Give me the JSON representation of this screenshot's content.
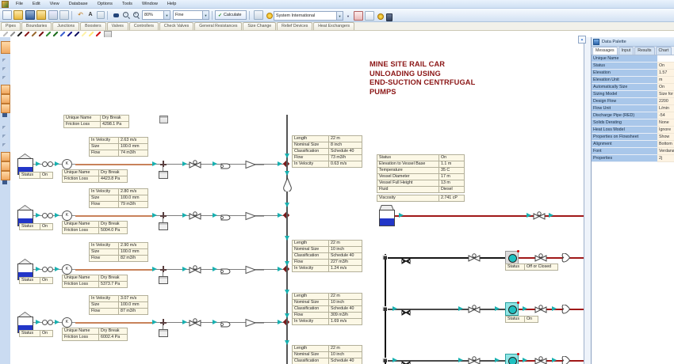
{
  "menu": {
    "items": [
      "File",
      "Edit",
      "View",
      "Database",
      "Options",
      "Tools",
      "Window",
      "Help"
    ]
  },
  "toolbar": {
    "zoom": "80%",
    "detail": "Fine",
    "calculate": "Calculate",
    "units": "System International"
  },
  "tabs": [
    "Pipes",
    "Boundaries",
    "Junctions",
    "Boosters",
    "Valves",
    "Controllers",
    "Check Valves",
    "General Resistances",
    "Size Change",
    "Relief Devices",
    "Heat Exchangers"
  ],
  "pen_colors": [
    "#b9b9b9",
    "#8f8f8f",
    "#1e1e1e",
    "#8b1a1a",
    "#9a6a30",
    "#7a1010",
    "#2e8b2e",
    "#1a6b1a",
    "#3a5fd0",
    "#15158b",
    "#101060",
    "#fff2a8",
    "#ffe97a",
    "#cc1111"
  ],
  "canvas": {
    "title_lines": [
      "MINE SITE RAIL CAR",
      "UNLOADING USING",
      "END-SUCTION CENTRFUGAL",
      "PUMPS"
    ],
    "labels": {
      "unique_name": "Unique Name",
      "friction_loss": "Friction Loss",
      "in_velocity": "In Velocity",
      "size": "Size",
      "flow": "Flow",
      "length": "Length",
      "nominal_size": "Nominal Size",
      "classification": "Classification",
      "status": "Status"
    },
    "dry_break_tables": [
      {
        "name": "Dry Break",
        "loss": "4298.1 Pa"
      },
      {
        "name": "Dry Break",
        "loss": "4423.8 Pa"
      },
      {
        "name": "Dry Break",
        "loss": "5004.0 Pa"
      },
      {
        "name": "Dry Break",
        "loss": "5373.7 Pa"
      },
      {
        "name": "Dry Break",
        "loss": "6002.4 Pa"
      }
    ],
    "velocity_tables": [
      {
        "in_velocity": "2.63 m/s",
        "size": "100.0 mm",
        "flow": "74 m3/h"
      },
      {
        "in_velocity": "2.80 m/s",
        "size": "100.0 mm",
        "flow": "79 m3/h"
      },
      {
        "in_velocity": "2.90 m/s",
        "size": "100.0 mm",
        "flow": "82 m3/h"
      },
      {
        "in_velocity": "3.07 m/s",
        "size": "100.0 mm",
        "flow": "87 m3/h"
      }
    ],
    "pipe_tables": [
      {
        "length": "22 m",
        "nominal_size": "8 inch",
        "classification": "Schedule 40",
        "flow": "73 m3/h",
        "in_velocity": "0.63 m/s"
      },
      {
        "length": "22 m",
        "nominal_size": "10 inch",
        "classification": "Schedule 40",
        "flow": "227 m3/h",
        "in_velocity": "1.24 m/s"
      },
      {
        "length": "22 m",
        "nominal_size": "10 inch",
        "classification": "Schedule 40",
        "flow": "309 m3/h",
        "in_velocity": "1.69 m/s"
      },
      {
        "length": "22 m",
        "nominal_size": "10 inch",
        "classification": "Schedule 40"
      }
    ],
    "vessel_table": [
      {
        "label": "Status",
        "value": "On"
      },
      {
        "label": "Elevation to Vessel Base",
        "value": "1.1 m"
      },
      {
        "label": "Temperature",
        "value": "35 C"
      },
      {
        "label": "Vessel Diameter",
        "value": "17 m"
      },
      {
        "label": "Vessel Full Height",
        "value": "13 m"
      },
      {
        "label": "Fluid",
        "value": "Diesel"
      },
      {
        "label": "Viscosity",
        "value": "2.741 cP"
      }
    ],
    "tank_status": [
      "On",
      "On",
      "On",
      "On"
    ],
    "pump_status": [
      {
        "label": "Status",
        "value": "Off or Closed"
      },
      {
        "label": "Status",
        "value": "On"
      }
    ]
  },
  "palette": {
    "title": "Data Palette",
    "tabs": [
      "Messages",
      "Input",
      "Results",
      "Chart"
    ],
    "rows": [
      {
        "label": "Unique Name",
        "value": ""
      },
      {
        "label": "Status",
        "value": "On"
      },
      {
        "label": "Elevation",
        "value": "1.57"
      },
      {
        "label": "Elevation Unit",
        "value": "m"
      },
      {
        "label": "Automatically Size",
        "value": "On"
      },
      {
        "label": "Sizing Model",
        "value": "Size for"
      },
      {
        "label": "Design Flow",
        "value": "2200"
      },
      {
        "label": "Flow Unit",
        "value": "L/min"
      },
      {
        "label": "Discharge Pipe (RED)",
        "value": "-54"
      },
      {
        "label": "Solids Derating",
        "value": "None"
      },
      {
        "label": "Heat Loss Model",
        "value": "Ignore"
      },
      {
        "label": "Properties on Flowsheet",
        "value": "Show"
      },
      {
        "label": "Alignment",
        "value": "Bottom"
      },
      {
        "label": "Font",
        "value": "Verdana"
      },
      {
        "label": "Properties",
        "value": "2j"
      }
    ]
  },
  "colors": {
    "teal": "#18b0b0",
    "red_line": "#a01818",
    "tan_line": "#c8825a",
    "gray_line": "#7d7d7d",
    "black_line": "#161616",
    "tank_blue": "#2236c8",
    "junction_red": "#7a1a1a"
  }
}
